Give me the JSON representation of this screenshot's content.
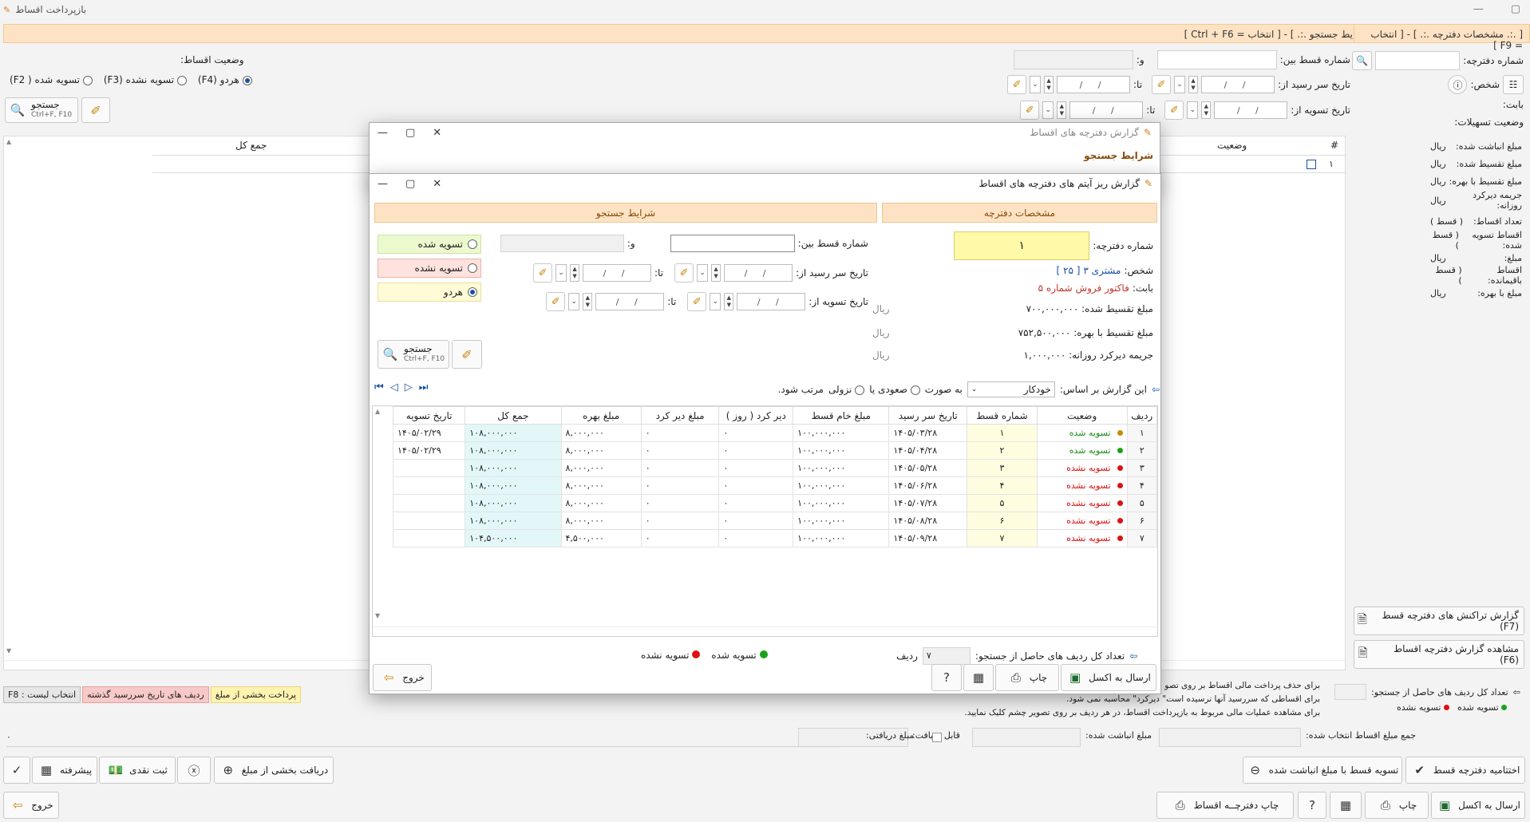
{
  "main": {
    "title": "بازپرداخت اقساط",
    "search_bar": "[ .:. شرایط جستجو .:. ] - [ انتخاب = Ctrl + F6 ]",
    "book_bar": "[ .:. مشخصات دفترچه .:. ] - [ انتخاب = F9 ]",
    "book_no_label": "شماره دفترچه:",
    "person_label": "شخص:",
    "regarding_label": "بابت:",
    "facility_status_label": "وضعیت تسهیلات:",
    "installment_between_label": "شماره قسط بین:",
    "and_label": "و:",
    "due_from_label": "تاریخ سر رسید از:",
    "settle_from_label": "تاریخ تسویه از:",
    "to_label": "تا:",
    "date_placeholder": "/ /",
    "status_label": "وضعیت اقساط:",
    "status_settled": "تسویه شده ( F2)",
    "status_unsettled": "تسویه نشده (F3)",
    "status_both": "هردو (F4)",
    "search_btn": "جستجو",
    "search_shortcut": "Ctrl+F, F10",
    "grid_col_total": "جمع کل",
    "grid_col_status": "وضعیت",
    "grid_col_hash": "#",
    "grid_row_num": "۱",
    "side_items": [
      {
        "label": "مبلغ انباشت شده:",
        "unit": "ریال"
      },
      {
        "label": "مبلغ تقسیط شده:",
        "unit": "ریال"
      },
      {
        "label": "مبلغ تقسیط با بهره:",
        "unit": "ریال"
      },
      {
        "label": "جریمه دیرکرد روزانه:",
        "unit": "ریال"
      },
      {
        "label": "تعداد اقساط:",
        "unit": "( قسط )"
      },
      {
        "label": "اقساط تسویه شده:",
        "unit": "( قسط )"
      },
      {
        "label": "مبلغ:",
        "unit": "ریال"
      },
      {
        "label": "اقساط باقیمانده:",
        "unit": "( قسط )"
      },
      {
        "label": "مبلغ با بهره:",
        "unit": "ریال"
      }
    ],
    "btn_transactions": "گزارش تراکنش های دفترچه قسط (F7)",
    "btn_view_report": "مشاهده گزارش دفترچه اقساط (F6)",
    "total_rows_label": "تعداد کل ردیف های حاصل از جستجو:",
    "legend_settled": "تسویه شده",
    "legend_unsettled": "تسویه نشده",
    "tag_partial": "پرداخت بخشی از مبلغ",
    "tag_overdue": "ردیف های تاریخ سررسید گذشته",
    "tag_select": "F8 : انتخاب لیست",
    "note1": "برای حذف پرداخت مالی اقساط بر روی تصو",
    "note2": "برای اقساطی که سررسید آنها نرسیده است\" دیرکرد\" محاسبه نمی شود.",
    "note3": "برای مشاهده عملیات مالی مربوط به بازپرداخت اقساط، در هر ردیف بر روی تصویر چشم کلیک نمایید.",
    "sum_selected_label": "جمع مبلغ اقساط انتخاب شده:",
    "accumulated_label": "مبلغ انباشت شده:",
    "receivable_label": "قابل دریافت:",
    "received_label": "مبلغ دریافتی:",
    "received_value": "۰",
    "btn_close_book": "اختتامیه دفترچه قسط",
    "btn_settle_accum": "تسویه قسط با مبلغ انباشت شده",
    "btn_receive_part": "دریافت بخشی از مبلغ",
    "btn_cash": "ثبت نقدی",
    "btn_advanced": "پیشرفته",
    "btn_excel": "ارسال به اکسل",
    "btn_print": "چاپ",
    "btn_print_book": "چاپ دفترچــه اقساط",
    "btn_exit": "خروج"
  },
  "bg_dialog": {
    "title": "گزارش دفترچه های اقساط",
    "section": "شرایط جستجو"
  },
  "dialog": {
    "title": "گزارش ریز آیتم های دفترچه های اقساط",
    "section_book": "مشخصات دفترچه",
    "section_search": "شرایط جستجو",
    "book_no_label": "شماره دفترچه:",
    "book_no_value": "۱",
    "person_label": "شخص:",
    "person_value": "مشتری ۳",
    "person_code": "[ ۲۵ ]",
    "regarding_label": "بابت:",
    "regarding_value": "فاکتور فروش شماره ۵",
    "amount_label": "مبلغ تقسیط شده:",
    "amount_value": "۷۰۰,۰۰۰,۰۰۰",
    "amount_interest_label": "مبلغ تقسیط با بهره:",
    "amount_interest_value": "۷۵۲,۵۰۰,۰۰۰",
    "penalty_label": "جریمه دیرکرد روزانه:",
    "penalty_value": "۱,۰۰۰,۰۰۰",
    "currency": "ریال",
    "installment_between_label": "شماره قسط بین:",
    "and_label": "و:",
    "due_from_label": "تاریخ سر رسید از:",
    "settle_from_label": "تاریخ تسویه از:",
    "to_label": "تا:",
    "date_placeholder": "/ /",
    "opt_settled": "تسویه شده",
    "opt_unsettled": "تسویه نشده",
    "opt_both": "هردو",
    "search_btn": "جستجو",
    "search_shortcut": "Ctrl+F, F10",
    "sort_prefix": "این گزارش بر اساس:",
    "sort_value": "خودکار",
    "sort_as": "به صورت",
    "sort_asc": "صعودی یا",
    "sort_desc": "نزولی",
    "sort_suffix": "مرتب شود.",
    "columns": [
      "ردیف",
      "وضعیت",
      "شماره قسط",
      "تاریخ سر رسید",
      "مبلغ خام قسط",
      "دیر کرد ( روز )",
      "مبلغ دیر کرد",
      "مبلغ بهره",
      "جمع کل",
      "تاریخ تسویه"
    ],
    "rows": [
      {
        "row": "۱",
        "dot": "#c98a00",
        "status": "تسویه شده",
        "status_color": "#1a8a1a",
        "num": "۱",
        "due": "۱۴۰۵/۰۳/۲۸",
        "raw": "۱۰۰,۰۰۰,۰۰۰",
        "late_days": "۰",
        "late_amt": "۰",
        "interest": "۸,۰۰۰,۰۰۰",
        "total": "۱۰۸,۰۰۰,۰۰۰",
        "settle": "۱۴۰۵/۰۲/۲۹"
      },
      {
        "row": "۲",
        "dot": "#1aa31a",
        "status": "تسویه شده",
        "status_color": "#1a8a1a",
        "num": "۲",
        "due": "۱۴۰۵/۰۴/۲۸",
        "raw": "۱۰۰,۰۰۰,۰۰۰",
        "late_days": "۰",
        "late_amt": "۰",
        "interest": "۸,۰۰۰,۰۰۰",
        "total": "۱۰۸,۰۰۰,۰۰۰",
        "settle": "۱۴۰۵/۰۲/۲۹"
      },
      {
        "row": "۳",
        "dot": "#d11",
        "status": "تسویه نشده",
        "status_color": "#d11",
        "num": "۳",
        "due": "۱۴۰۵/۰۵/۲۸",
        "raw": "۱۰۰,۰۰۰,۰۰۰",
        "late_days": "۰",
        "late_amt": "۰",
        "interest": "۸,۰۰۰,۰۰۰",
        "total": "۱۰۸,۰۰۰,۰۰۰",
        "settle": ""
      },
      {
        "row": "۴",
        "dot": "#d11",
        "status": "تسویه نشده",
        "status_color": "#d11",
        "num": "۴",
        "due": "۱۴۰۵/۰۶/۲۸",
        "raw": "۱۰۰,۰۰۰,۰۰۰",
        "late_days": "۰",
        "late_amt": "۰",
        "interest": "۸,۰۰۰,۰۰۰",
        "total": "۱۰۸,۰۰۰,۰۰۰",
        "settle": ""
      },
      {
        "row": "۵",
        "dot": "#d11",
        "status": "تسویه نشده",
        "status_color": "#d11",
        "num": "۵",
        "due": "۱۴۰۵/۰۷/۲۸",
        "raw": "۱۰۰,۰۰۰,۰۰۰",
        "late_days": "۰",
        "late_amt": "۰",
        "interest": "۸,۰۰۰,۰۰۰",
        "total": "۱۰۸,۰۰۰,۰۰۰",
        "settle": ""
      },
      {
        "row": "۶",
        "dot": "#d11",
        "status": "تسویه نشده",
        "status_color": "#d11",
        "num": "۶",
        "due": "۱۴۰۵/۰۸/۲۸",
        "raw": "۱۰۰,۰۰۰,۰۰۰",
        "late_days": "۰",
        "late_amt": "۰",
        "interest": "۸,۰۰۰,۰۰۰",
        "total": "۱۰۸,۰۰۰,۰۰۰",
        "settle": ""
      },
      {
        "row": "۷",
        "dot": "#d11",
        "status": "تسویه نشده",
        "status_color": "#d11",
        "num": "۷",
        "due": "۱۴۰۵/۰۹/۲۸",
        "raw": "۱۰۰,۰۰۰,۰۰۰",
        "late_days": "۰",
        "late_amt": "۰",
        "interest": "۴,۵۰۰,۰۰۰",
        "total": "۱۰۴,۵۰۰,۰۰۰",
        "settle": ""
      }
    ],
    "total_rows_label": "تعداد کل ردیف های حاصل از جستجو:",
    "total_rows_value": "۷",
    "rows_unit": "ردیف",
    "legend_settled": "تسویه شده",
    "legend_unsettled": "تسویه نشده",
    "btn_excel": "ارسال به اکسل",
    "btn_print": "چاپ",
    "btn_exit": "خروج"
  }
}
